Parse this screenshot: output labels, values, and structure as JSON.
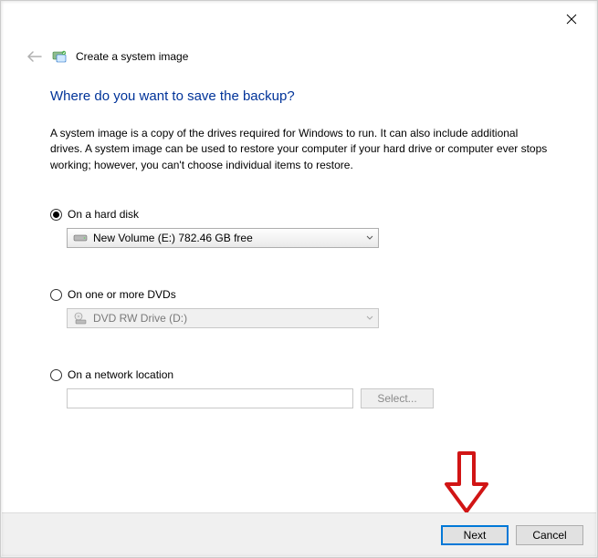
{
  "window": {
    "title": "Create a system image"
  },
  "page": {
    "heading": "Where do you want to save the backup?",
    "description": "A system image is a copy of the drives required for Windows to run. It can also include additional drives. A system image can be used to restore your computer if your hard drive or computer ever stops working; however, you can't choose individual items to restore."
  },
  "options": {
    "hard_disk": {
      "label": "On a hard disk",
      "selected": true,
      "drive_text": "New Volume (E:)  782.46 GB free"
    },
    "dvd": {
      "label": "On one or more DVDs",
      "selected": false,
      "drive_text": "DVD RW Drive (D:)"
    },
    "network": {
      "label": "On a network location",
      "selected": false,
      "path_value": "",
      "select_button": "Select..."
    }
  },
  "footer": {
    "next": "Next",
    "cancel": "Cancel"
  }
}
